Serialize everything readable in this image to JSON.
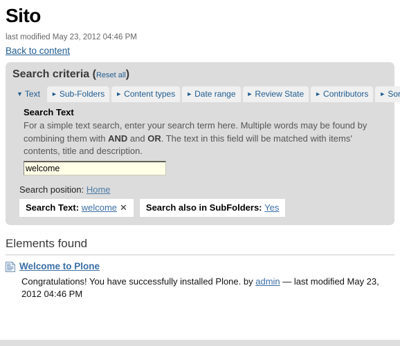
{
  "page": {
    "title": "Sito",
    "byline": "last modified May 23, 2012 04:46 PM",
    "back_link": "Back to content"
  },
  "criteria": {
    "heading": "Search criteria",
    "paren_open": "(",
    "paren_close": ")",
    "reset_all": "Reset all",
    "tabs": [
      {
        "label": "Text",
        "marker": "▼",
        "active": true
      },
      {
        "label": "Sub-Folders",
        "marker": "►",
        "active": false
      },
      {
        "label": "Content types",
        "marker": "►",
        "active": false
      },
      {
        "label": "Date range",
        "marker": "►",
        "active": false
      },
      {
        "label": "Review State",
        "marker": "►",
        "active": false
      },
      {
        "label": "Contributors",
        "marker": "►",
        "active": false
      },
      {
        "label": "Sort",
        "marker": "►",
        "active": false
      }
    ],
    "field": {
      "label": "Search Text",
      "help_part1": "For a simple text search, enter your search term here. Multiple words may be found by combining them with ",
      "help_and": "AND",
      "help_mid": " and ",
      "help_or": "OR",
      "help_part2": ". The text in this field will be matched with items' contents, title and description.",
      "input_value": "welcome",
      "input_placeholder": ""
    },
    "position_label": "Search position:",
    "position_value": "Home",
    "pills": [
      {
        "label": "Search Text:",
        "value": "welcome",
        "remove": "✕",
        "removable": true
      },
      {
        "label": "Search also in SubFolders:",
        "value": "Yes",
        "remove": "",
        "removable": false
      }
    ]
  },
  "results": {
    "heading": "Elements found",
    "items": [
      {
        "icon": "document-icon",
        "title": "Welcome to Plone",
        "description": "Congratulations! You have successfully installed Plone.",
        "by_label": "by",
        "author": "admin",
        "dash": "—",
        "modified": "last modified May 23, 2012 04:46 PM"
      }
    ]
  },
  "colors": {
    "link": "#205c90",
    "panel_bg": "#dcdcdc",
    "tab_bg": "#f0f0f0",
    "input_bg": "#ffffe8",
    "heading": "#3a3a3a"
  }
}
